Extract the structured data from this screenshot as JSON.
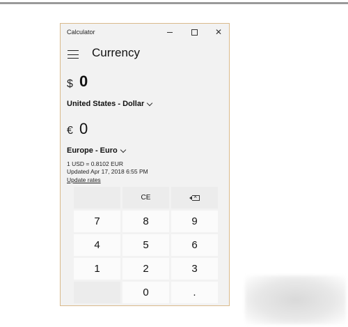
{
  "window": {
    "title": "Calculator",
    "close_glyph": "✕"
  },
  "header": {
    "mode_title": "Currency",
    "menu_icon": "hamburger-icon"
  },
  "converter": {
    "from_symbol": "$",
    "from_value": "0",
    "from_unit": "United States - Dollar",
    "to_symbol": "€",
    "to_value": "0",
    "to_unit": "Europe - Euro",
    "rate": "1 USD = 0.8102 EUR",
    "updated": "Updated Apr 17, 2018 6:55 PM",
    "update_link": "Update rates"
  },
  "keypad": {
    "ce": "CE",
    "backspace_icon": "backspace-icon",
    "keys": [
      "7",
      "8",
      "9",
      "4",
      "5",
      "6",
      "1",
      "2",
      "3",
      "0",
      "."
    ]
  }
}
